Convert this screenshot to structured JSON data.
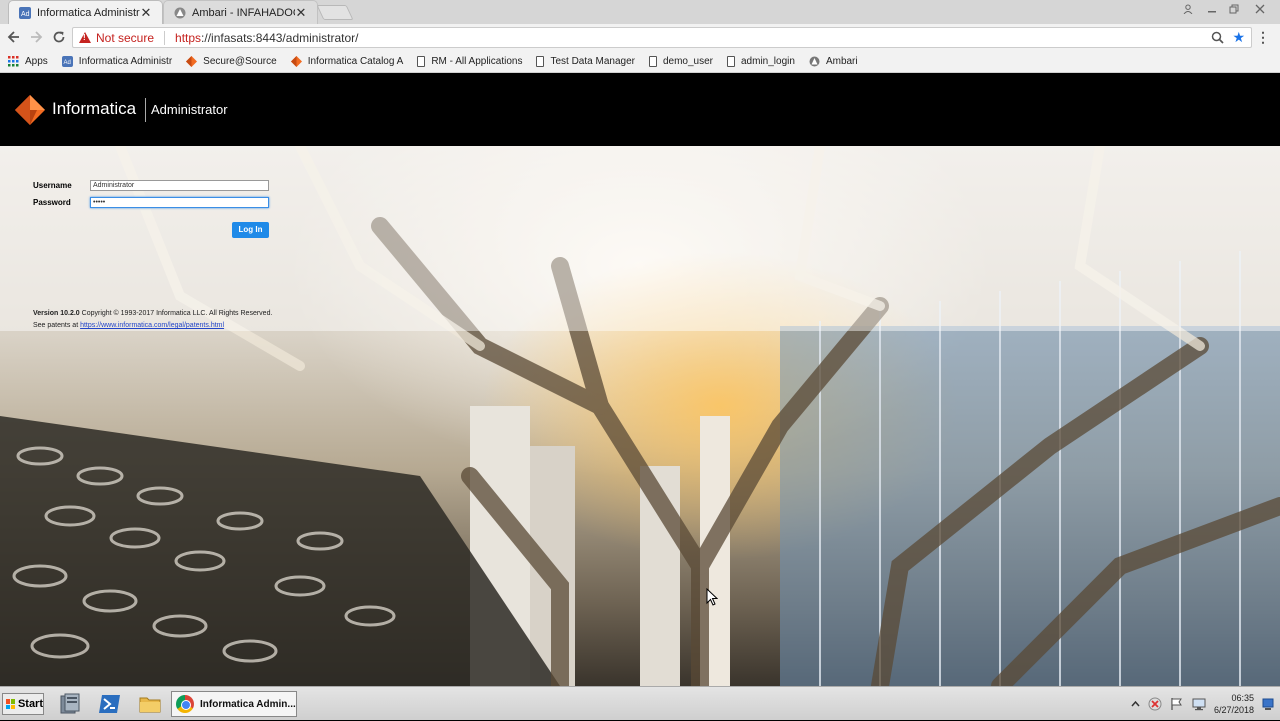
{
  "browser": {
    "tabs": [
      {
        "title": "Informatica Administrator",
        "active": true
      },
      {
        "title": "Ambari - INFAHADOOP",
        "active": false
      }
    ],
    "close_glyph": "✕",
    "security_label": "Not secure",
    "url_scheme": "https",
    "url_rest": "://infasats:8443/administrator/",
    "bookmarks": [
      {
        "label": "Apps",
        "icon": "apps-grid-icon"
      },
      {
        "label": "Informatica Administr",
        "icon": "informatica-admin-icon"
      },
      {
        "label": "Secure@Source",
        "icon": "informatica-logo-icon"
      },
      {
        "label": "Informatica Catalog A",
        "icon": "informatica-logo-icon"
      },
      {
        "label": "RM - All Applications",
        "icon": "page-icon"
      },
      {
        "label": "Test Data Manager",
        "icon": "page-icon"
      },
      {
        "label": "demo_user",
        "icon": "page-icon"
      },
      {
        "label": "admin_login",
        "icon": "page-icon"
      },
      {
        "label": "Ambari",
        "icon": "ambari-icon"
      }
    ]
  },
  "header": {
    "brand": "Informatica",
    "product": "Administrator"
  },
  "login": {
    "username_label": "Username",
    "username_value": "Administrator",
    "password_label": "Password",
    "password_value": "•••••",
    "login_button": "Log In"
  },
  "footer": {
    "version_label": "Version 10.2.0",
    "copyright": " Copyright © 1993-2017 Informatica LLC. All Rights Reserved.",
    "patents_label": "See patents at ",
    "patents_link": "https://www.informatica.com/legal/patents.html"
  },
  "taskbar": {
    "start_label": "Start",
    "active_task": "Informatica Admin...",
    "time": "06:35",
    "date": "6/27/2018"
  },
  "colors": {
    "accent": "#1f8ae8",
    "brand_orange": "#f26b21",
    "header_bg": "#000000"
  }
}
